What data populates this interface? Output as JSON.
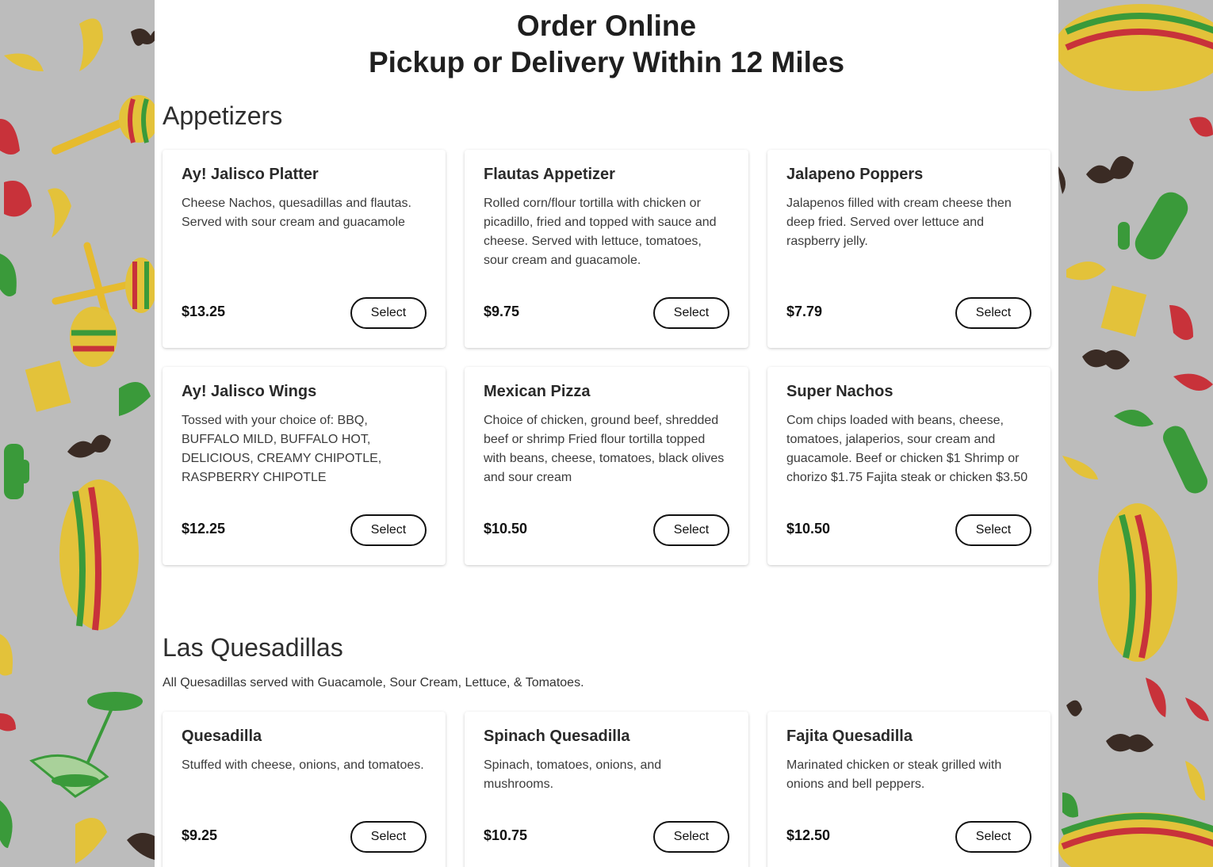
{
  "header": {
    "line1": "Order Online",
    "line2": "Pickup or Delivery Within 12 Miles"
  },
  "sections": [
    {
      "title": "Appetizers",
      "description": "",
      "items": [
        {
          "name": "Ay! Jalisco Platter",
          "description": "Cheese Nachos, quesadillas and flautas. Served with sour cream and guacamole",
          "price": "$13.25",
          "button": "Select"
        },
        {
          "name": "Flautas Appetizer",
          "description": "Rolled corn/flour tortilla with chicken or picadillo, fried and topped with sauce and cheese. Served with lettuce, tomatoes, sour cream and guacamole.",
          "price": "$9.75",
          "button": "Select"
        },
        {
          "name": "Jalapeno Poppers",
          "description": "Jalapenos filled with cream cheese then deep fried. Served over lettuce and raspberry jelly.",
          "price": "$7.79",
          "button": "Select"
        },
        {
          "name": "Ay! Jalisco Wings",
          "description": "Tossed with your choice of: BBQ, BUFFALO MILD, BUFFALO HOT, DELICIOUS, CREAMY CHIPOTLE, RASPBERRY CHIPOTLE",
          "price": "$12.25",
          "button": "Select"
        },
        {
          "name": "Mexican Pizza",
          "description": "Choice of chicken, ground beef, shredded beef or shrimp Fried flour tortilla topped with beans, cheese, tomatoes, black olives and sour cream",
          "price": "$10.50",
          "button": "Select"
        },
        {
          "name": "Super Nachos",
          "description": "Com chips loaded with beans, cheese, tomatoes, jalaperios, sour cream and guacamole. Beef or chicken $1 Shrimp or chorizo $1.75 Fajita steak or chicken $3.50",
          "price": "$10.50",
          "button": "Select"
        }
      ]
    },
    {
      "title": "Las Quesadillas",
      "description": "All Quesadillas served with Guacamole, Sour Cream, Lettuce, & Tomatoes.",
      "items": [
        {
          "name": "Quesadilla",
          "description": "Stuffed with cheese, onions, and tomatoes.",
          "price": "$9.25",
          "button": "Select"
        },
        {
          "name": "Spinach Quesadilla",
          "description": "Spinach, tomatoes, onions, and mushrooms.",
          "price": "$10.75",
          "button": "Select"
        },
        {
          "name": "Fajita Quesadilla",
          "description": "Marinated chicken or steak grilled with onions and bell peppers.",
          "price": "$12.50",
          "button": "Select"
        }
      ]
    }
  ],
  "colors": {
    "background": "#bcbcbc",
    "panel": "#ffffff",
    "text": "#2b2b2b",
    "price": "#111111",
    "button_border": "#111111"
  }
}
